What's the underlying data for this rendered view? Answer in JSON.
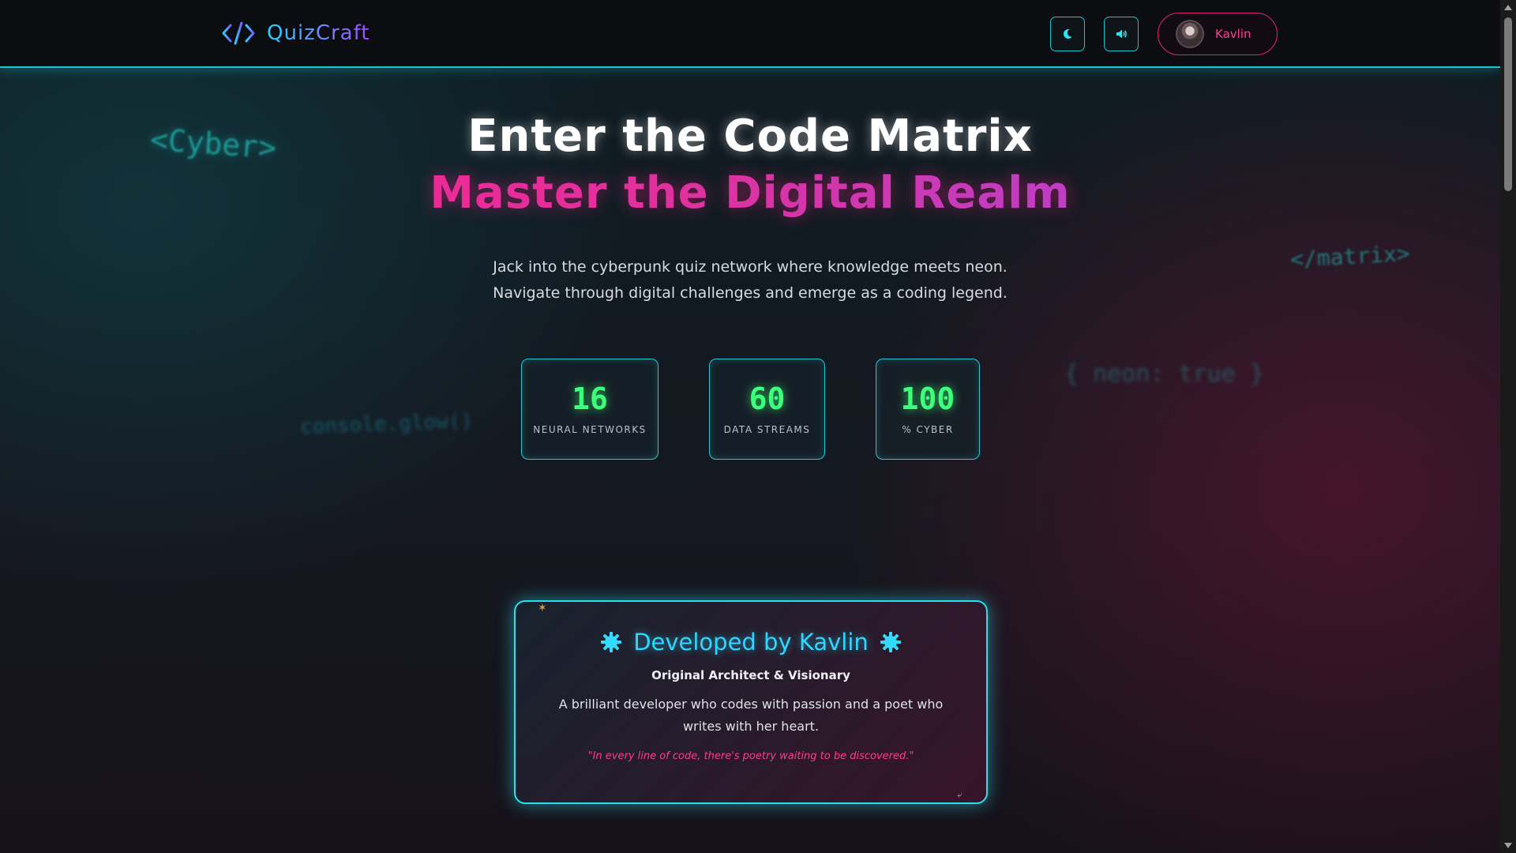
{
  "navbar": {
    "brand": "QuizCraft",
    "theme_icon": "moon-icon",
    "sound_icon": "speaker-icon",
    "user": {
      "name": "Kavlin"
    }
  },
  "background_code": {
    "cyber": "<Cyber>",
    "matrix": "</matrix>",
    "neon": "{ neon: true }",
    "console": "console.glow()"
  },
  "hero": {
    "title": "Enter the Code Matrix",
    "subtitle": "Master the Digital Realm",
    "description_line1": "Jack into the cyberpunk quiz network where knowledge meets neon.",
    "description_line2": "Navigate through digital challenges and emerge as a coding legend."
  },
  "stats": [
    {
      "value": "16",
      "label": "NEURAL NETWORKS"
    },
    {
      "value": "60",
      "label": "DATA STREAMS"
    },
    {
      "value": "100",
      "label": "% CYBER"
    }
  ],
  "developer": {
    "title": "Developed by Kavlin",
    "role": "Original Architect & Visionary",
    "bio": "A brilliant developer who codes with passion and a poet who writes with her heart.",
    "quote": "\"In every line of code, there's poetry waiting to be discovered.\""
  },
  "colors": {
    "accent_cyan": "#19c4d3",
    "accent_pink": "#ff1e8c",
    "stat_green": "#3cff7a",
    "background": "#0d1014"
  }
}
